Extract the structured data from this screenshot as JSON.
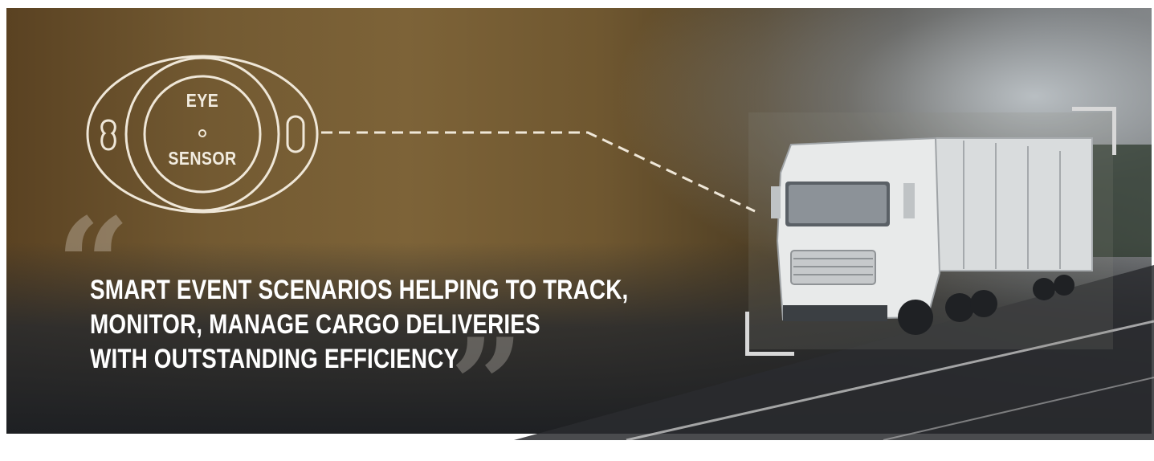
{
  "sensor": {
    "line1": "EYE",
    "line2": "SENSOR"
  },
  "headline": {
    "line1": "SMART EVENT SCENARIOS HELPING TO TRACK,",
    "line2": "MONITOR, MANAGE CARGO DELIVERIES",
    "line3": "WITH OUTSTANDING EFFICIENCY"
  },
  "quote_open": "“",
  "quote_close": "”",
  "colors": {
    "text": "#ffffff",
    "sensor_outline": "#efe7d8",
    "frame": "#d8d8d8"
  },
  "icons": [
    "eye-sensor-device-icon",
    "truck-illustration"
  ]
}
